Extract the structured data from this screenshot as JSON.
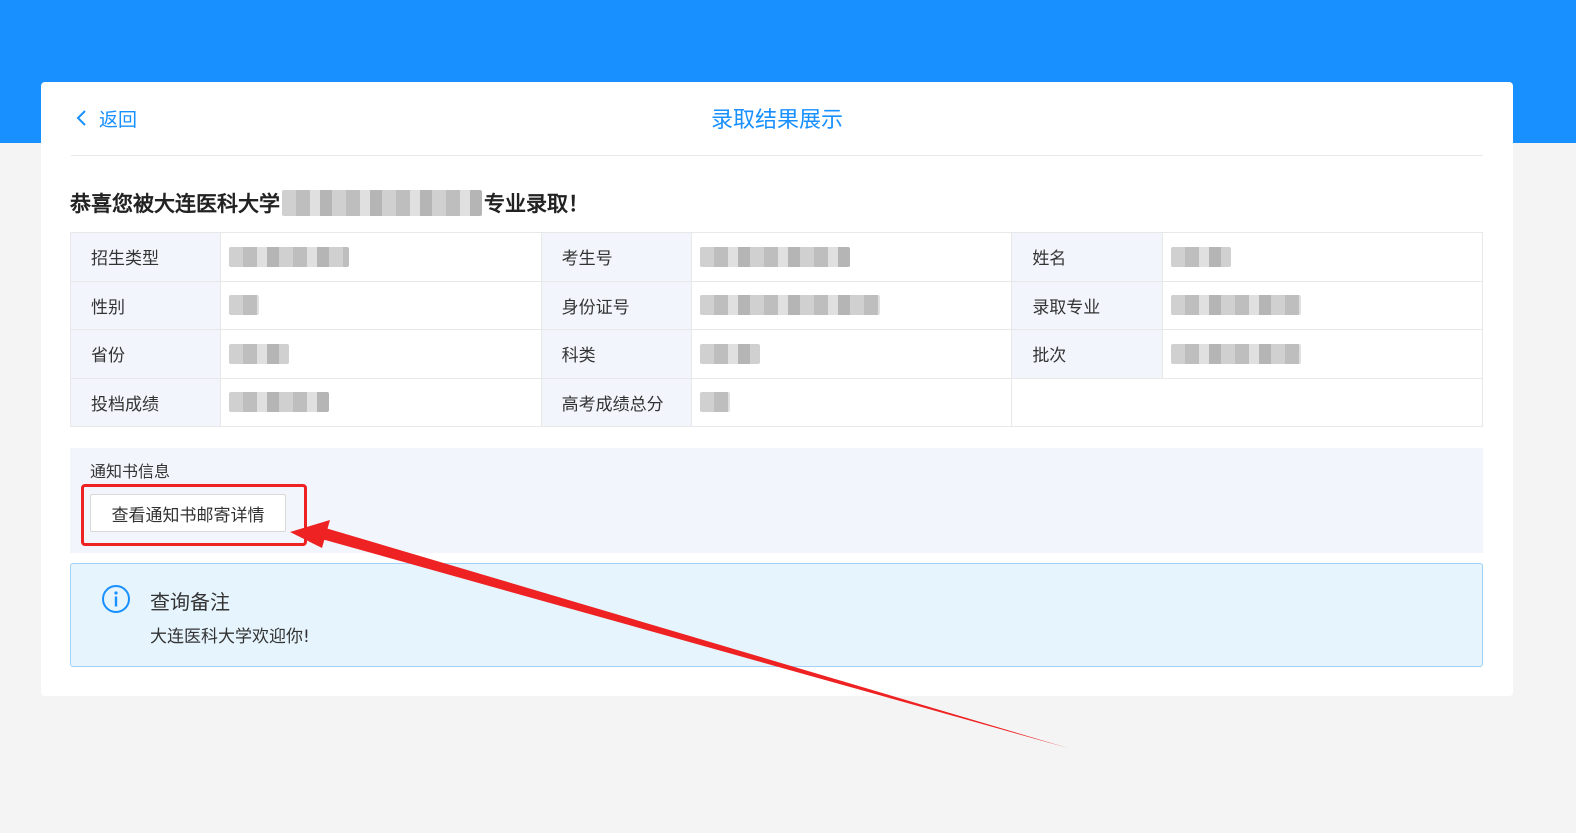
{
  "header": {
    "back_label": "返回",
    "title": "录取结果展示"
  },
  "headline": {
    "prefix": "恭喜您被大连医科大学",
    "suffix": "专业录取！"
  },
  "table": {
    "rows": [
      [
        {
          "label": "招生类型"
        },
        {
          "label": "考生号"
        },
        {
          "label": "姓名"
        }
      ],
      [
        {
          "label": "性别"
        },
        {
          "label": "身份证号"
        },
        {
          "label": "录取专业"
        }
      ],
      [
        {
          "label": "省份"
        },
        {
          "label": "科类"
        },
        {
          "label": "批次"
        }
      ],
      [
        {
          "label": "投档成绩"
        },
        {
          "label": "高考成绩总分"
        }
      ]
    ]
  },
  "notice": {
    "label": "通知书信息",
    "button_label": "查看通知书邮寄详情"
  },
  "remark": {
    "title": "查询备注",
    "text": "大连医科大学欢迎你!"
  },
  "colors": {
    "brand": "#1890ff",
    "annotation": "#ee2222",
    "info_bg": "#e6f4fd"
  },
  "icons": {
    "back": "chevron-left-icon",
    "info": "info-circle-icon"
  }
}
